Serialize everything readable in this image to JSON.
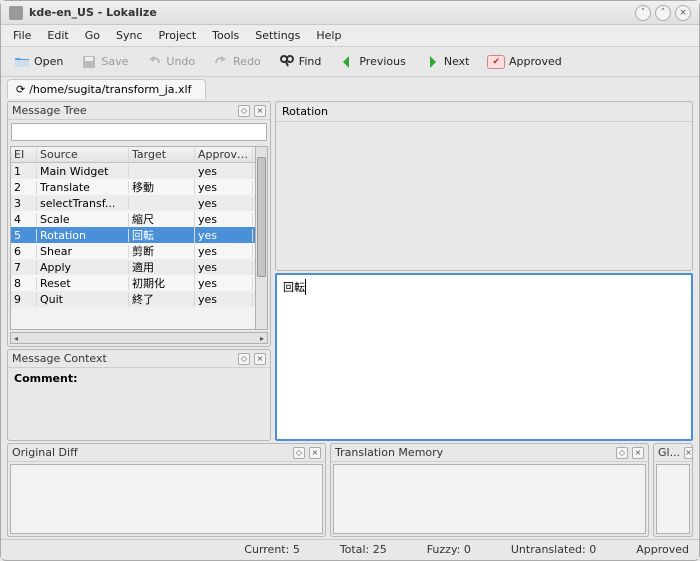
{
  "window": {
    "title": "kde-en_US - Lokalize"
  },
  "menu": {
    "file": "File",
    "edit": "Edit",
    "go": "Go",
    "sync": "Sync",
    "project": "Project",
    "tools": "Tools",
    "settings": "Settings",
    "help": "Help"
  },
  "toolbar": {
    "open": "Open",
    "save": "Save",
    "undo": "Undo",
    "redo": "Redo",
    "find": "Find",
    "previous": "Previous",
    "next": "Next",
    "approved": "Approved"
  },
  "tab": {
    "path": "/home/sugita/transform_ja.xlf"
  },
  "panels": {
    "messageTree": "Message Tree",
    "messageContext": "Message Context",
    "originalDiff": "Original Diff",
    "translationMemory": "Translation Memory",
    "glossary": "Gl...",
    "rotation": "Rotation",
    "comment": "Comment:"
  },
  "table": {
    "headers": {
      "entry": "EI",
      "source": "Source",
      "target": "Target",
      "approved": "Approved"
    },
    "rows": [
      {
        "n": "1",
        "source": "Main Widget",
        "target": "",
        "approved": "yes"
      },
      {
        "n": "2",
        "source": "Translate",
        "target": "移動",
        "approved": "yes"
      },
      {
        "n": "3",
        "source": "selectTransf...",
        "target": "",
        "approved": "yes"
      },
      {
        "n": "4",
        "source": "Scale",
        "target": "縮尺",
        "approved": "yes"
      },
      {
        "n": "5",
        "source": "Rotation",
        "target": "回転",
        "approved": "yes",
        "selected": true
      },
      {
        "n": "6",
        "source": "Shear",
        "target": "剪断",
        "approved": "yes"
      },
      {
        "n": "7",
        "source": "Apply",
        "target": "適用",
        "approved": "yes"
      },
      {
        "n": "8",
        "source": "Reset",
        "target": "初期化",
        "approved": "yes"
      },
      {
        "n": "9",
        "source": "Quit",
        "target": "終了",
        "approved": "yes"
      }
    ]
  },
  "editor": {
    "text": "回転"
  },
  "status": {
    "current": "Current: 5",
    "total": "Total: 25",
    "fuzzy": "Fuzzy: 0",
    "untranslated": "Untranslated: 0",
    "approved": "Approved"
  }
}
